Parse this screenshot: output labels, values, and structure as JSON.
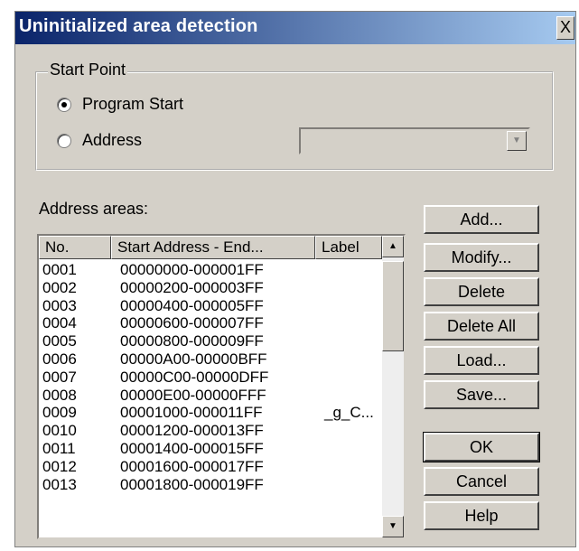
{
  "window": {
    "title": "Uninitialized area detection",
    "close_glyph": "X"
  },
  "start_point": {
    "label": "Start Point",
    "options": [
      {
        "label": "Program Start",
        "selected": true
      },
      {
        "label": "Address",
        "selected": false
      }
    ],
    "address_value": ""
  },
  "address_areas": {
    "label": "Address areas:",
    "columns": [
      "No.",
      "Start Address - End...",
      "Label"
    ],
    "rows": [
      {
        "no": "0001",
        "range": "00000000-000001FF",
        "label": ""
      },
      {
        "no": "0002",
        "range": "00000200-000003FF",
        "label": ""
      },
      {
        "no": "0003",
        "range": "00000400-000005FF",
        "label": ""
      },
      {
        "no": "0004",
        "range": "00000600-000007FF",
        "label": ""
      },
      {
        "no": "0005",
        "range": "00000800-000009FF",
        "label": ""
      },
      {
        "no": "0006",
        "range": "00000A00-00000BFF",
        "label": ""
      },
      {
        "no": "0007",
        "range": "00000C00-00000DFF",
        "label": ""
      },
      {
        "no": "0008",
        "range": "00000E00-00000FFF",
        "label": ""
      },
      {
        "no": "0009",
        "range": "00001000-000011FF",
        "label": "_g_C..."
      },
      {
        "no": "0010",
        "range": "00001200-000013FF",
        "label": ""
      },
      {
        "no": "0011",
        "range": "00001400-000015FF",
        "label": ""
      },
      {
        "no": "0012",
        "range": "00001600-000017FF",
        "label": ""
      },
      {
        "no": "0013",
        "range": "00001800-000019FF",
        "label": ""
      }
    ]
  },
  "buttons": {
    "add": "Add...",
    "modify": "Modify...",
    "delete": "Delete",
    "delete_all": "Delete All",
    "load": "Load...",
    "save": "Save...",
    "ok": "OK",
    "cancel": "Cancel",
    "help": "Help"
  },
  "colors": {
    "title_start": "#0a246a",
    "title_end": "#a6caf0",
    "face": "#d4d0c8"
  }
}
